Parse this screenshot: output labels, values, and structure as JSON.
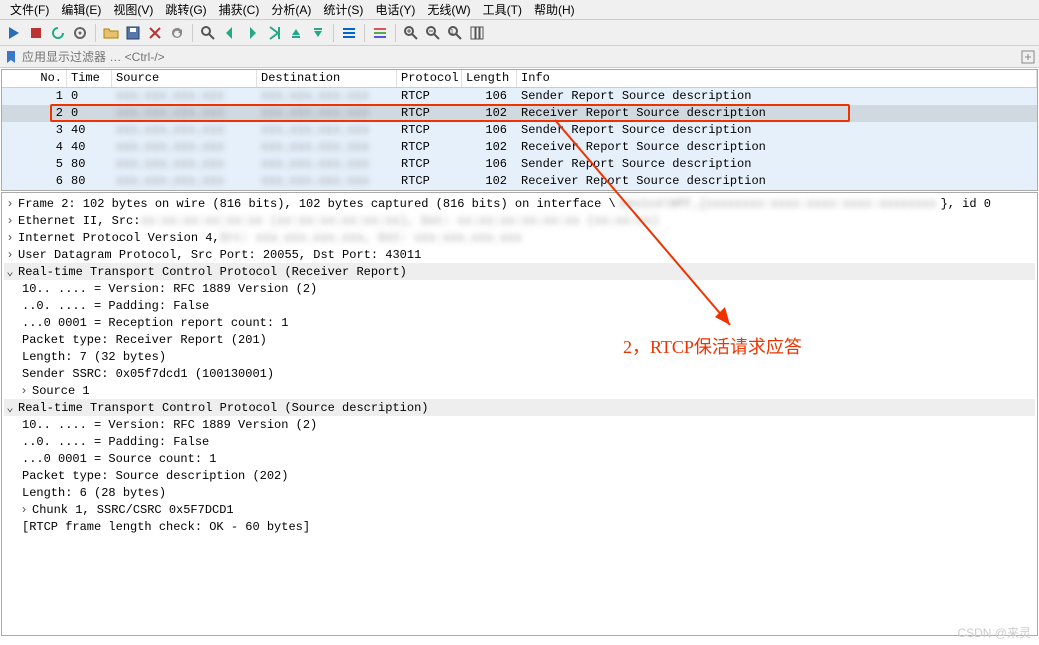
{
  "menu": {
    "items": [
      "文件(F)",
      "编辑(E)",
      "视图(V)",
      "跳转(G)",
      "捕获(C)",
      "分析(A)",
      "统计(S)",
      "电话(Y)",
      "无线(W)",
      "工具(T)",
      "帮助(H)"
    ]
  },
  "filter": {
    "placeholder": "应用显示过滤器 … <Ctrl-/>"
  },
  "columns": {
    "no": "No.",
    "time": "Time",
    "src": "Source",
    "dst": "Destination",
    "proto": "Protocol",
    "len": "Length",
    "info": "Info"
  },
  "packets": [
    {
      "no": "1",
      "time": "0",
      "proto": "RTCP",
      "len": "106",
      "info": "Sender Report   Source description"
    },
    {
      "no": "2",
      "time": "0",
      "proto": "RTCP",
      "len": "102",
      "info": "Receiver Report   Source description"
    },
    {
      "no": "3",
      "time": "40",
      "proto": "RTCP",
      "len": "106",
      "info": "Sender Report   Source description"
    },
    {
      "no": "4",
      "time": "40",
      "proto": "RTCP",
      "len": "102",
      "info": "Receiver Report   Source description"
    },
    {
      "no": "5",
      "time": "80",
      "proto": "RTCP",
      "len": "106",
      "info": "Sender Report   Source description"
    },
    {
      "no": "6",
      "time": "80",
      "proto": "RTCP",
      "len": "102",
      "info": "Receiver Report   Source description"
    }
  ],
  "details": {
    "frame": "Frame 2: 102 bytes on wire (816 bits), 102 bytes captured (816 bits) on interface \\",
    "frame_tail": "}, id 0",
    "eth": "Ethernet II, Src: ",
    "ip": "Internet Protocol Version 4, ",
    "udp": "User Datagram Protocol, Src Port: 20055, Dst Port: 43011",
    "rtcp1_hdr": "Real-time Transport Control Protocol (Receiver Report)",
    "rtcp1": {
      "version": "10.. .... = Version: RFC 1889 Version (2)",
      "padding": "..0. .... = Padding: False",
      "count": "...0 0001 = Reception report count: 1",
      "ptype": "Packet type: Receiver Report (201)",
      "length": "Length: 7 (32 bytes)",
      "ssrc": "Sender SSRC: 0x05f7dcd1 (100130001)",
      "source1": "Source 1"
    },
    "rtcp2_hdr": "Real-time Transport Control Protocol (Source description)",
    "rtcp2": {
      "version": "10.. .... = Version: RFC 1889 Version (2)",
      "padding": "..0. .... = Padding: False",
      "count": "...0 0001 = Source count: 1",
      "ptype": "Packet type: Source description (202)",
      "length": "Length: 6 (28 bytes)",
      "chunk": "Chunk 1, SSRC/CSRC 0x5F7DCD1",
      "check": "[RTCP frame length check: OK - 60 bytes]"
    }
  },
  "annotation": {
    "text": "2，RTCP保活请求应答"
  },
  "watermark": {
    "text": "CSDN @来灵"
  }
}
